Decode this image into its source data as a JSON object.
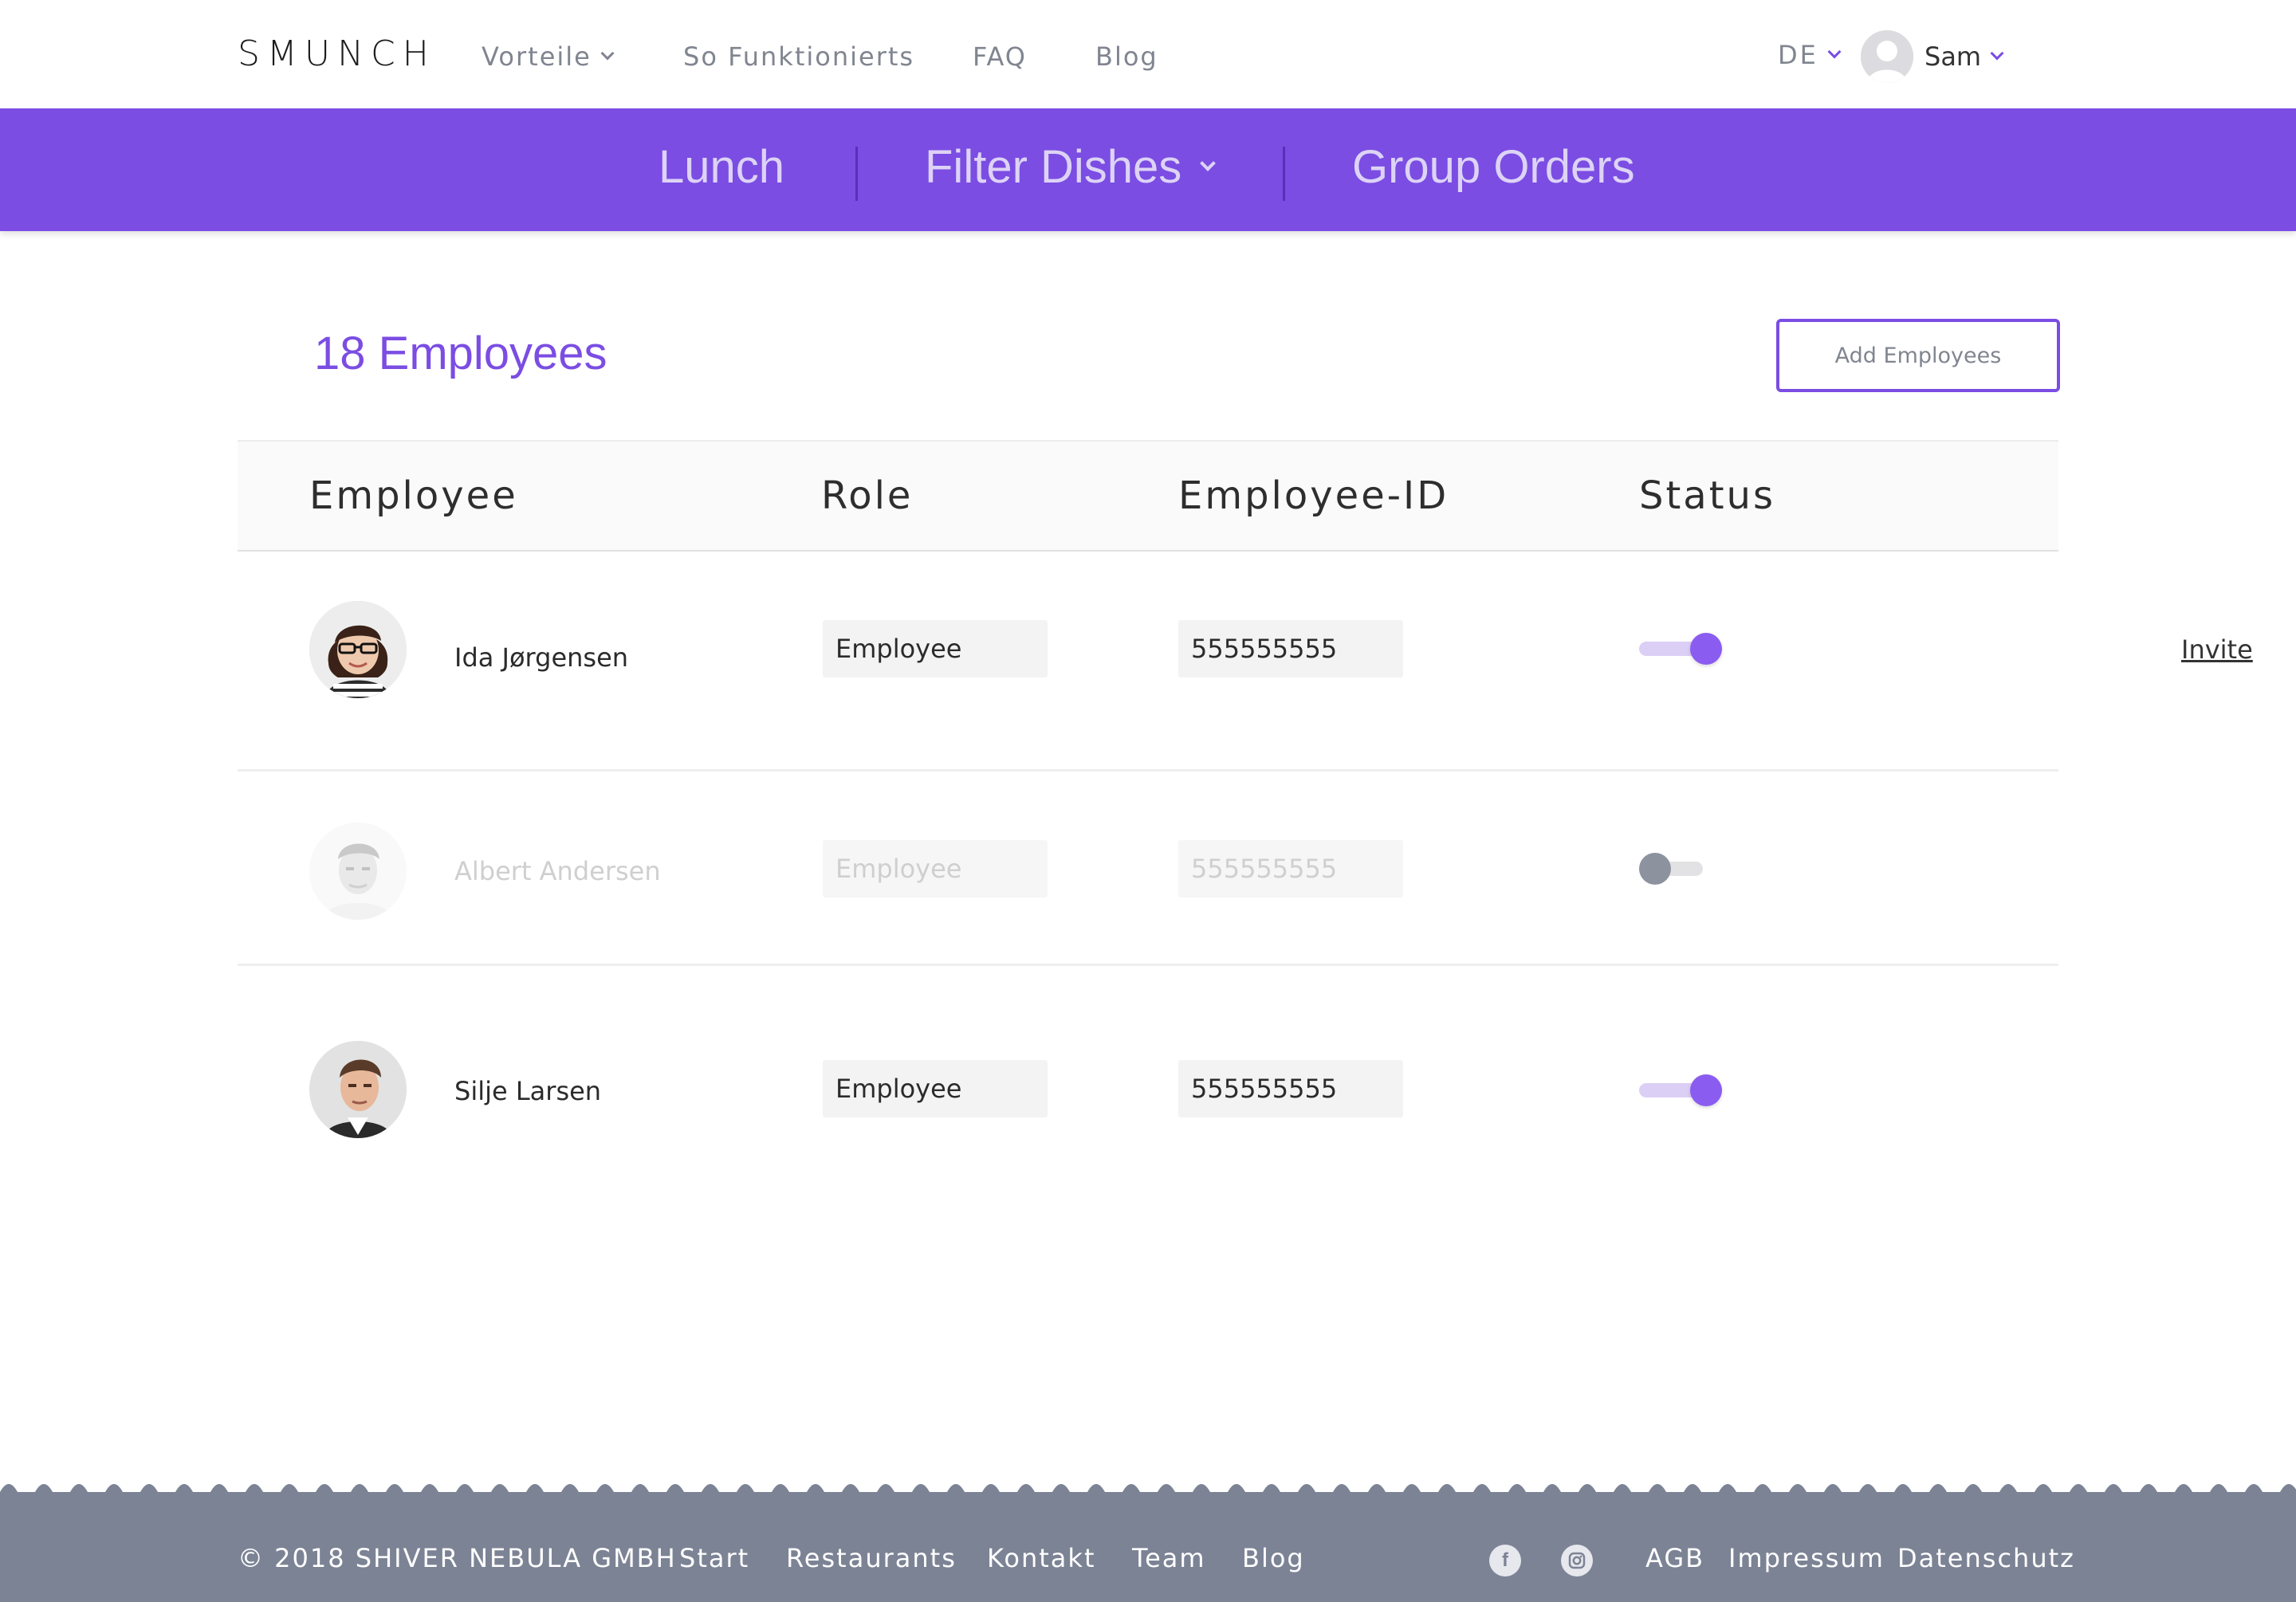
{
  "brand": {
    "logo": "SMUNCH"
  },
  "nav": {
    "links": [
      "Vorteile",
      "So Funktionierts",
      "FAQ",
      "Blog"
    ],
    "language": "DE",
    "user_name": "Sam"
  },
  "subnav": {
    "items": [
      "Lunch",
      "Filter Dishes",
      "Group Orders"
    ]
  },
  "main": {
    "employee_count": "18 Employees",
    "add_button": "Add Employees",
    "columns": [
      "Employee",
      "Role",
      "Employee-ID",
      "Status"
    ],
    "rows": [
      {
        "name": "Ida Jørgensen",
        "role": "Employee",
        "employee_id": "555555555",
        "status_on": true,
        "action": "Invite"
      },
      {
        "name": "Albert Andersen",
        "role": "Employee",
        "employee_id": "555555555",
        "status_on": false,
        "action": ""
      },
      {
        "name": "Silje Larsen",
        "role": "Employee",
        "employee_id": "555555555",
        "status_on": true,
        "action": ""
      }
    ]
  },
  "footer": {
    "copyright": "© 2018 SHIVER NEBULA GMBH",
    "links": [
      "Start",
      "Restaurants",
      "Kontakt",
      "Team",
      "Blog"
    ],
    "legal": [
      "AGB",
      "Impressum",
      "Datenschutz"
    ],
    "social_icons": [
      "facebook-icon",
      "instagram-icon"
    ]
  },
  "colors": {
    "accent": "#7b4de3",
    "footer_bg": "#7c8395",
    "toggle_on": "#8b5cf0",
    "toggle_off": "#8d929f"
  }
}
